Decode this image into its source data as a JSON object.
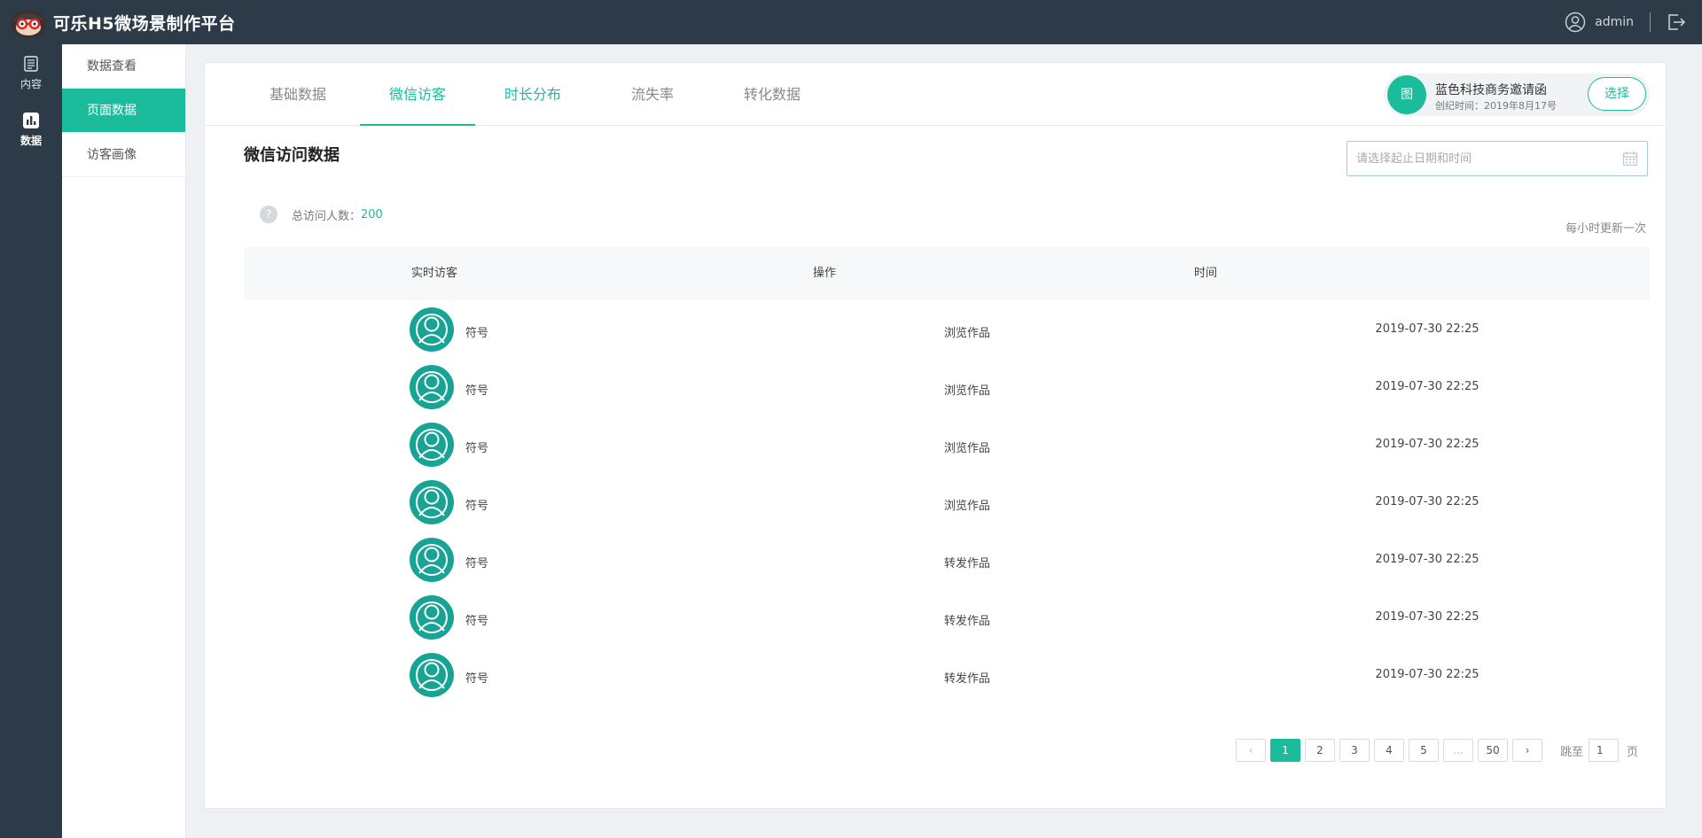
{
  "app": {
    "title": "可乐H5微场景制作平台"
  },
  "header": {
    "user_name": "admin"
  },
  "leftnav": {
    "items": [
      {
        "label": "内容"
      },
      {
        "label": "数据"
      }
    ]
  },
  "subnav": {
    "items": [
      {
        "label": "数据查看"
      },
      {
        "label": "页面数据"
      },
      {
        "label": "访客画像"
      }
    ]
  },
  "tabs": [
    {
      "label": "基础数据"
    },
    {
      "label": "微信访客"
    },
    {
      "label": "时长分布"
    },
    {
      "label": "流失率"
    },
    {
      "label": "转化数据"
    }
  ],
  "invite": {
    "avatar_text": "图",
    "title": "蓝色科技商务邀请函",
    "date": "创纪时间：2019年8月17号",
    "button": "选择"
  },
  "section": {
    "title": "微信访问数据"
  },
  "date_input": {
    "placeholder": "请选择起止日期和时间"
  },
  "stats": {
    "help": "?",
    "total_label": "总访问人数：",
    "total_value": "200",
    "update_note": "每小时更新一次"
  },
  "table": {
    "headers": [
      "实时访客",
      "操作",
      "时间"
    ],
    "rows": [
      {
        "name": "符号",
        "op": "浏览作品",
        "time": "2019-07-30 22:25"
      },
      {
        "name": "符号",
        "op": "浏览作品",
        "time": "2019-07-30 22:25"
      },
      {
        "name": "符号",
        "op": "浏览作品",
        "time": "2019-07-30 22:25"
      },
      {
        "name": "符号",
        "op": "浏览作品",
        "time": "2019-07-30 22:25"
      },
      {
        "name": "符号",
        "op": "转发作品",
        "time": "2019-07-30 22:25"
      },
      {
        "name": "符号",
        "op": "转发作品",
        "time": "2019-07-30 22:25"
      },
      {
        "name": "符号",
        "op": "转发作品",
        "time": "2019-07-30 22:25"
      }
    ]
  },
  "pagination": {
    "prev": "‹",
    "next": "›",
    "pages": [
      "1",
      "2",
      "3",
      "4",
      "5",
      "...",
      "50"
    ],
    "current": "1",
    "jump_label": "跳至",
    "jump_value": "1",
    "jump_suffix": "页"
  },
  "colors": {
    "accent": "#1abc9c",
    "topbar": "#2d3a47",
    "avatar": "#18a494"
  }
}
